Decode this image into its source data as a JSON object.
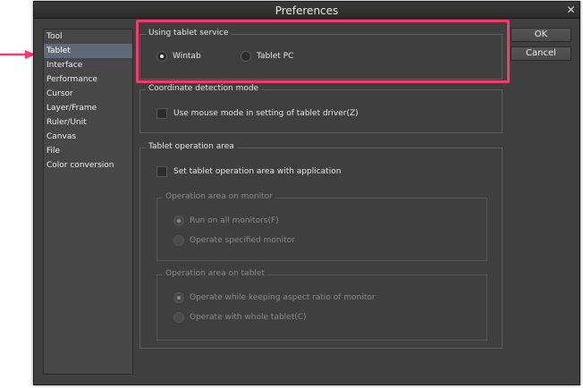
{
  "window": {
    "title": "Preferences",
    "close_glyph": "✕"
  },
  "sidebar": {
    "items": [
      {
        "label": "Tool"
      },
      {
        "label": "Tablet"
      },
      {
        "label": "Interface"
      },
      {
        "label": "Performance"
      },
      {
        "label": "Cursor"
      },
      {
        "label": "Layer/Frame"
      },
      {
        "label": "Ruler/Unit"
      },
      {
        "label": "Canvas"
      },
      {
        "label": "File"
      },
      {
        "label": "Color conversion"
      }
    ],
    "selected": "Tablet"
  },
  "tablet_service": {
    "label": "Using tablet service",
    "options": [
      {
        "label": "Wintab",
        "checked": true
      },
      {
        "label": "Tablet PC",
        "checked": false
      }
    ]
  },
  "coordinate_detection": {
    "label": "Coordinate detection mode",
    "checkbox_label": "Use mouse mode in setting of tablet driver(Z)"
  },
  "operation_area": {
    "label": "Tablet operation area",
    "checkbox_label": "Set tablet operation area with application",
    "monitor_group": {
      "label": "Operation area on monitor",
      "options": [
        {
          "label": "Run on all monitors(F)",
          "checked": true
        },
        {
          "label": "Operate specified monitor",
          "checked": false
        }
      ]
    },
    "tablet_group": {
      "label": "Operation area on tablet",
      "options": [
        {
          "label": "Operate while keeping aspect ratio of monitor",
          "checked": true
        },
        {
          "label": "Operate with whole tablet(C)",
          "checked": false
        }
      ]
    }
  },
  "buttons": {
    "ok": "OK",
    "cancel": "Cancel"
  },
  "colors": {
    "highlight": "#f03c6e",
    "window_bg": "#3f3f3f",
    "selected_item": "#5e6a78"
  },
  "annotations": {
    "pointer": "arrow-right-icon"
  }
}
